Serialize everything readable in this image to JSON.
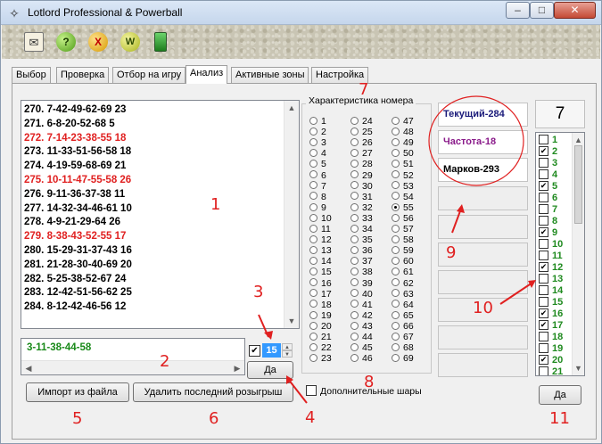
{
  "window": {
    "title": "Lotlord Professional & Powerball",
    "app_icon": "compass-icon",
    "buttons": [
      "minimize-icon",
      "maximize-icon",
      "close-icon"
    ]
  },
  "toolbar": {
    "buttons": [
      {
        "icon": "envelope-icon"
      },
      {
        "icon": "help-icon",
        "label": "?"
      },
      {
        "icon": "cancel-icon",
        "label": "X"
      },
      {
        "icon": "web-icon",
        "label": "W"
      },
      {
        "icon": "phone-icon"
      }
    ]
  },
  "tabs": [
    "Выбор",
    "Проверка",
    "Отбор на игру",
    "Анализ",
    "Активные зоны",
    "Настройка"
  ],
  "active_tab": "Анализ",
  "draws": [
    {
      "text": "270.  7-42-49-62-69 23",
      "color": "black"
    },
    {
      "text": "271.  6-8-20-52-68 5",
      "color": "black"
    },
    {
      "text": "272.  7-14-23-38-55 18",
      "color": "red"
    },
    {
      "text": "273.  11-33-51-56-58 18",
      "color": "black"
    },
    {
      "text": "274.  4-19-59-68-69 21",
      "color": "black"
    },
    {
      "text": "275.  10-11-47-55-58 26",
      "color": "red"
    },
    {
      "text": "276.  9-11-36-37-38 11",
      "color": "black"
    },
    {
      "text": "277.  14-32-34-46-61 10",
      "color": "black"
    },
    {
      "text": "278.  4-9-21-29-64 26",
      "color": "black"
    },
    {
      "text": "279.  8-38-43-52-55 17",
      "color": "red"
    },
    {
      "text": "280.  15-29-31-37-43 16",
      "color": "black"
    },
    {
      "text": "281.  21-28-30-40-69 20",
      "color": "black"
    },
    {
      "text": "282.  5-25-38-52-67 24",
      "color": "black"
    },
    {
      "text": "283.  12-42-51-56-62 25",
      "color": "black"
    },
    {
      "text": "284.  8-12-42-46-56 12",
      "color": "black"
    }
  ],
  "entry_value": "3-11-38-44-58",
  "spinner": {
    "checked": true,
    "value": "15"
  },
  "buttons": {
    "ok_mid": "Да",
    "import": "Импорт из файла",
    "delete_last": "Удалить последний розыгрыш",
    "ok_right": "Да"
  },
  "number_group": {
    "title": "Характеристика номера",
    "selected": 55,
    "columns": [
      [
        "1",
        "2",
        "3",
        "4",
        "5",
        "6",
        "7",
        "8",
        "9",
        "10",
        "11",
        "12",
        "13",
        "14",
        "15",
        "16",
        "17",
        "18",
        "19",
        "20",
        "21",
        "22",
        "23"
      ],
      [
        "24",
        "25",
        "26",
        "27",
        "28",
        "29",
        "30",
        "31",
        "32",
        "33",
        "34",
        "35",
        "36",
        "37",
        "38",
        "39",
        "40",
        "41",
        "42",
        "43",
        "44",
        "45",
        "46"
      ],
      [
        "47",
        "48",
        "49",
        "50",
        "51",
        "52",
        "53",
        "54",
        "55",
        "56",
        "57",
        "58",
        "59",
        "60",
        "61",
        "62",
        "63",
        "64",
        "65",
        "66",
        "67",
        "68",
        "69"
      ]
    ]
  },
  "extra_balls": {
    "label": "Дополнительные шары",
    "checked": false
  },
  "stats": {
    "current": "Текущий-284",
    "frequency": "Частота-18",
    "markov": "Марков-293",
    "colors": {
      "current": "#1a1a7a",
      "frequency": "#8a1a8a",
      "markov": "#000000"
    },
    "empty_slots": 8
  },
  "selected_count": "7",
  "number_list": [
    {
      "n": "1",
      "checked": false
    },
    {
      "n": "2",
      "checked": true
    },
    {
      "n": "3",
      "checked": false
    },
    {
      "n": "4",
      "checked": false
    },
    {
      "n": "5",
      "checked": true
    },
    {
      "n": "6",
      "checked": false
    },
    {
      "n": "7",
      "checked": false
    },
    {
      "n": "8",
      "checked": false
    },
    {
      "n": "9",
      "checked": true
    },
    {
      "n": "10",
      "checked": false
    },
    {
      "n": "11",
      "checked": false
    },
    {
      "n": "12",
      "checked": true
    },
    {
      "n": "13",
      "checked": false
    },
    {
      "n": "14",
      "checked": false
    },
    {
      "n": "15",
      "checked": false
    },
    {
      "n": "16",
      "checked": true
    },
    {
      "n": "17",
      "checked": true
    },
    {
      "n": "18",
      "checked": false
    },
    {
      "n": "19",
      "checked": false
    },
    {
      "n": "20",
      "checked": true
    },
    {
      "n": "21",
      "checked": false
    }
  ],
  "annotations": {
    "labels": [
      "1",
      "2",
      "3",
      "4",
      "5",
      "6",
      "7",
      "8",
      "9",
      "10",
      "11"
    ],
    "color": "#e02020"
  }
}
